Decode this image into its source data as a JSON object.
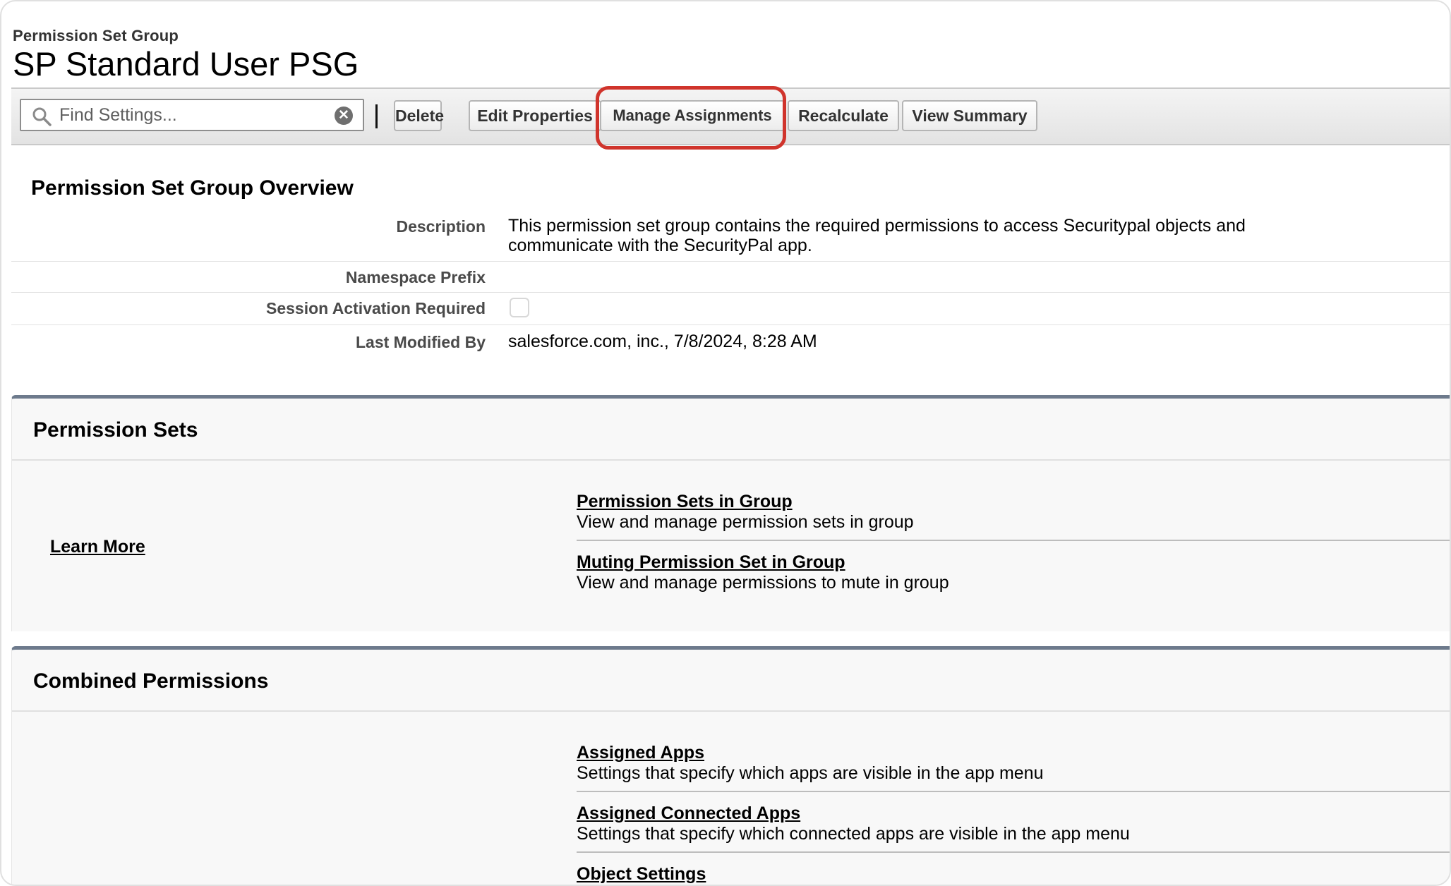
{
  "header": {
    "eyebrow": "Permission Set Group",
    "title": "SP Standard User PSG"
  },
  "toolbar": {
    "search_placeholder": "Find Settings...",
    "search_value": "",
    "delete_label": "Delete",
    "edit_properties_label": "Edit Properties",
    "manage_assignments_label": "Manage Assignments",
    "recalculate_label": "Recalculate",
    "view_summary_label": "View Summary",
    "highlight_color": "#d0342c"
  },
  "overview": {
    "title": "Permission Set Group Overview",
    "description_label": "Description",
    "description_value_line1": "This permission set group contains the required permissions to access Securitypal objects and",
    "description_value_line2": "communicate with the SecurityPal app.",
    "namespace_prefix_label": "Namespace Prefix",
    "namespace_prefix_value": "",
    "session_activation_label": "Session Activation Required",
    "session_activation_checked": false,
    "last_modified_label": "Last Modified By",
    "last_modified_value": "salesforce.com, inc., 7/8/2024, 8:28 AM"
  },
  "permission_sets": {
    "title": "Permission Sets",
    "learn_more": "Learn More",
    "items": [
      {
        "title": "Permission Sets in Group",
        "description": "View and manage permission sets in group"
      },
      {
        "title": "Muting Permission Set in Group",
        "description": "View and manage permissions to mute in group"
      }
    ]
  },
  "combined_permissions": {
    "title": "Combined Permissions",
    "items": [
      {
        "title": "Assigned Apps",
        "description": "Settings that specify which apps are visible in the app menu"
      },
      {
        "title": "Assigned Connected Apps",
        "description": "Settings that specify which connected apps are visible in the app menu"
      },
      {
        "title": "Object Settings",
        "description": ""
      }
    ]
  },
  "colors": {
    "section_rule": "#6d7a8c",
    "section_bg": "#f8f8f8"
  }
}
